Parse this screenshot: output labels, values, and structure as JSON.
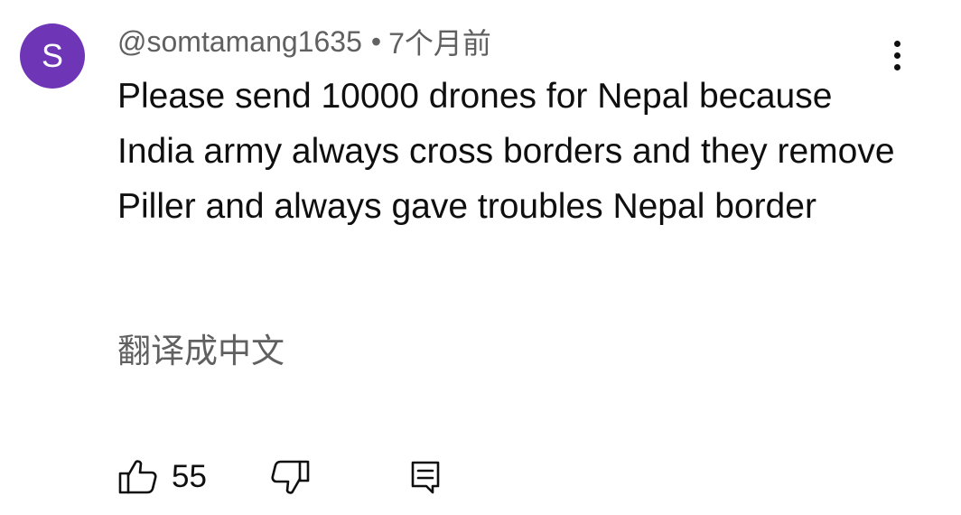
{
  "comment": {
    "avatar_letter": "S",
    "avatar_color": "#6f35b7",
    "author": "@somtamang1635",
    "separator": "•",
    "time": "7个月前",
    "text": "Please send 10000 drones for Nepal because India army always cross borders and they remove Piller and always gave troubles Nepal border",
    "translate_label": "翻译成中文",
    "like_count": "55"
  },
  "icons": {
    "more": "more-vertical-icon",
    "like": "thumbs-up-icon",
    "dislike": "thumbs-down-icon",
    "reply": "reply-comment-icon"
  },
  "colors": {
    "text_primary": "#0f0f0f",
    "text_secondary": "#606060",
    "background": "#ffffff"
  }
}
